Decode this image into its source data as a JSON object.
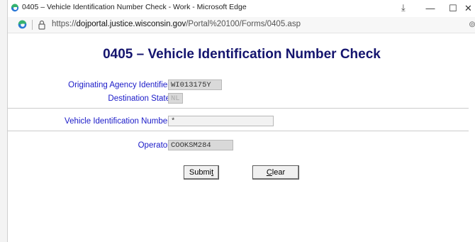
{
  "window": {
    "title": "0405 – Vehicle Identification Number Check - Work - Microsoft Edge",
    "controls": {
      "minimize": "—",
      "maximize": "☐",
      "close": "✕"
    },
    "extension_icon": "pin-extension-icon"
  },
  "address": {
    "url_prefix": "https://",
    "url_host": "dojportal.justice.wisconsin.gov",
    "url_path": "/Portal%20100/Forms/0405.asp"
  },
  "form": {
    "title": "0405 – Vehicle Identification Number Check",
    "fields": {
      "originating_agency": {
        "label": "Originating Agency Identifier",
        "value": "WI013175Y"
      },
      "destination_state": {
        "label": "Destination State",
        "value": "NL"
      },
      "vin": {
        "label": "Vehicle Identification Number",
        "value": "*"
      },
      "operator": {
        "label": "Operator",
        "value": "COOKSM284"
      }
    },
    "buttons": {
      "submit_pre": "Submi",
      "submit_u": "t",
      "clear_u": "C",
      "clear_post": "lear"
    }
  },
  "colors": {
    "label_blue": "#1a1ac8",
    "title_navy": "#14146e"
  }
}
